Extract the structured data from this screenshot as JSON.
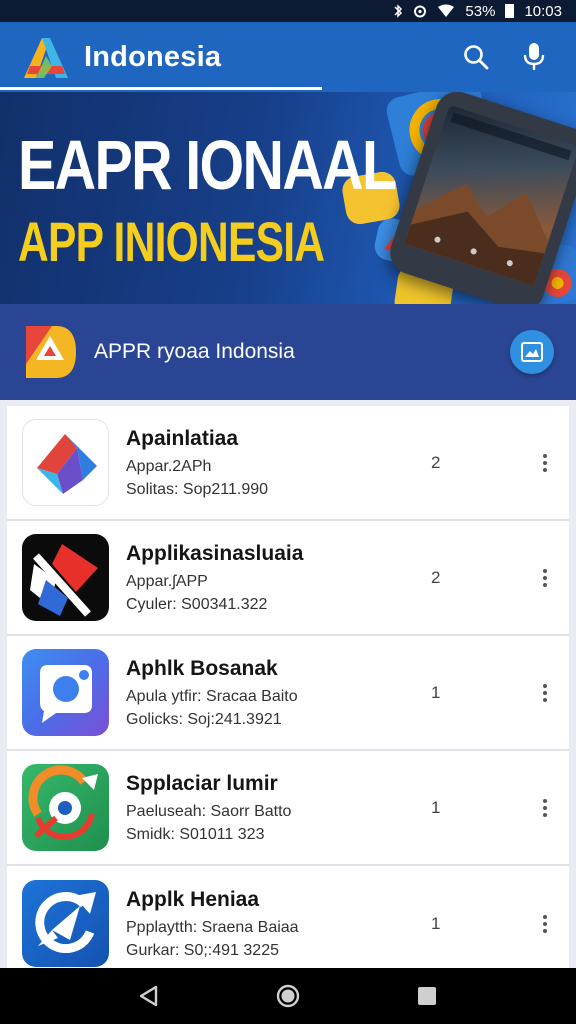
{
  "status_bar": {
    "battery": "53%",
    "time": "10:03",
    "icons": [
      "bluetooth-icon",
      "alarm-icon",
      "wifi-icon",
      "battery-icon"
    ]
  },
  "app_bar": {
    "title": "Indonesia",
    "actions": [
      "search-icon",
      "mic-icon"
    ]
  },
  "banner": {
    "headline": "EAPR IONAAL",
    "subheadline": "APP INIONESIA",
    "colors": {
      "headline": "#ffffff",
      "subheadline": "#f4cd1d"
    }
  },
  "featured": {
    "label": "APPR ryoaa Indonsia",
    "action_icon": "image-icon"
  },
  "apps": [
    {
      "name": "Apainlatiaa",
      "subtitle": "Appar.2APh",
      "meta": "Solitas: Sop211.990",
      "count": "2",
      "icon": "arrow-logo-icon"
    },
    {
      "name": "Applikasinasluaia",
      "subtitle": "Appar.ʃAPP",
      "meta": "Cyuler: S00341.322",
      "count": "2",
      "icon": "diamond-logo-icon"
    },
    {
      "name": "Aphlk Bosanak",
      "subtitle": "Apula ytfir: Sracaa Baito",
      "meta": "Golicks: Soj:241.3921",
      "count": "1",
      "icon": "chat-bubble-icon"
    },
    {
      "name": "Spplaciar lumir",
      "subtitle": "Paeluseah: Saorr Batto",
      "meta": "Smidk: S01011 323",
      "count": "1",
      "icon": "compass-icon"
    },
    {
      "name": "Applk Heniaa",
      "subtitle": "Ppplaytth: Sraena Baiaa",
      "meta": "Gurkar: S0;:491 3225",
      "count": "1",
      "icon": "circle-arrow-icon"
    }
  ],
  "nav": [
    "back-icon",
    "home-icon",
    "recents-icon"
  ]
}
